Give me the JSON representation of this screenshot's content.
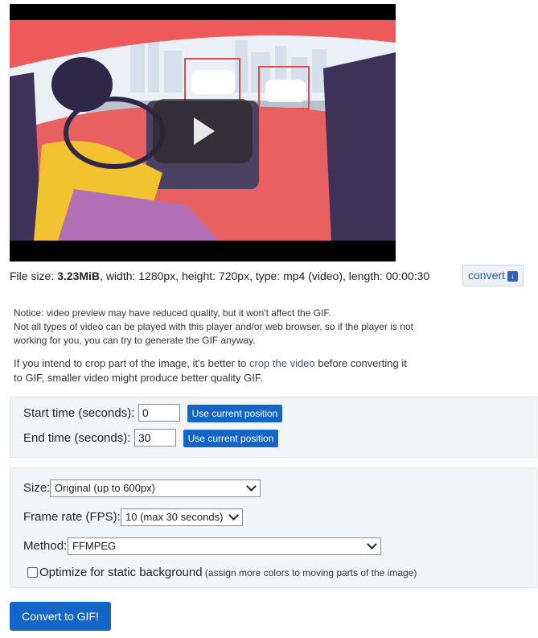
{
  "video": {
    "play_icon": "play-icon"
  },
  "file_info": {
    "prefix": "File size: ",
    "size": "3.23MiB",
    "rest": ", width: 1280px, height: 720px, type: mp4 (video), length: 00:00:30",
    "convert_label": "convert",
    "convert_icon": "download-icon"
  },
  "notice": {
    "line1": "Notice: video preview may have reduced quality, but it won't affect the GIF.",
    "line2": "Not all types of video can be played with this player and/or web browser, so if the player is not",
    "line3": "working for you, you can try to generate the GIF anyway."
  },
  "crop": {
    "before": "If you intend to crop part of the image, it's better to ",
    "link": "crop the video",
    "after": " before converting it",
    "line2": "to GIF, smaller video might produce better quality GIF."
  },
  "time": {
    "start_label": "Start time (seconds):",
    "start_value": "0",
    "end_label": "End time (seconds):",
    "end_value": "30",
    "use_current": "Use current position"
  },
  "options": {
    "size_label": "Size:",
    "size_value": "Original (up to 600px)",
    "fps_label": "Frame rate (FPS):",
    "fps_value": "10 (max 30 seconds)",
    "method_label": "Method:",
    "method_value": "FFMPEG",
    "optimize_label": "Optimize for static background",
    "optimize_note": " (assign more colors to moving parts of the image)",
    "optimize_checked": false
  },
  "convert_gif_label": "Convert to GIF!"
}
